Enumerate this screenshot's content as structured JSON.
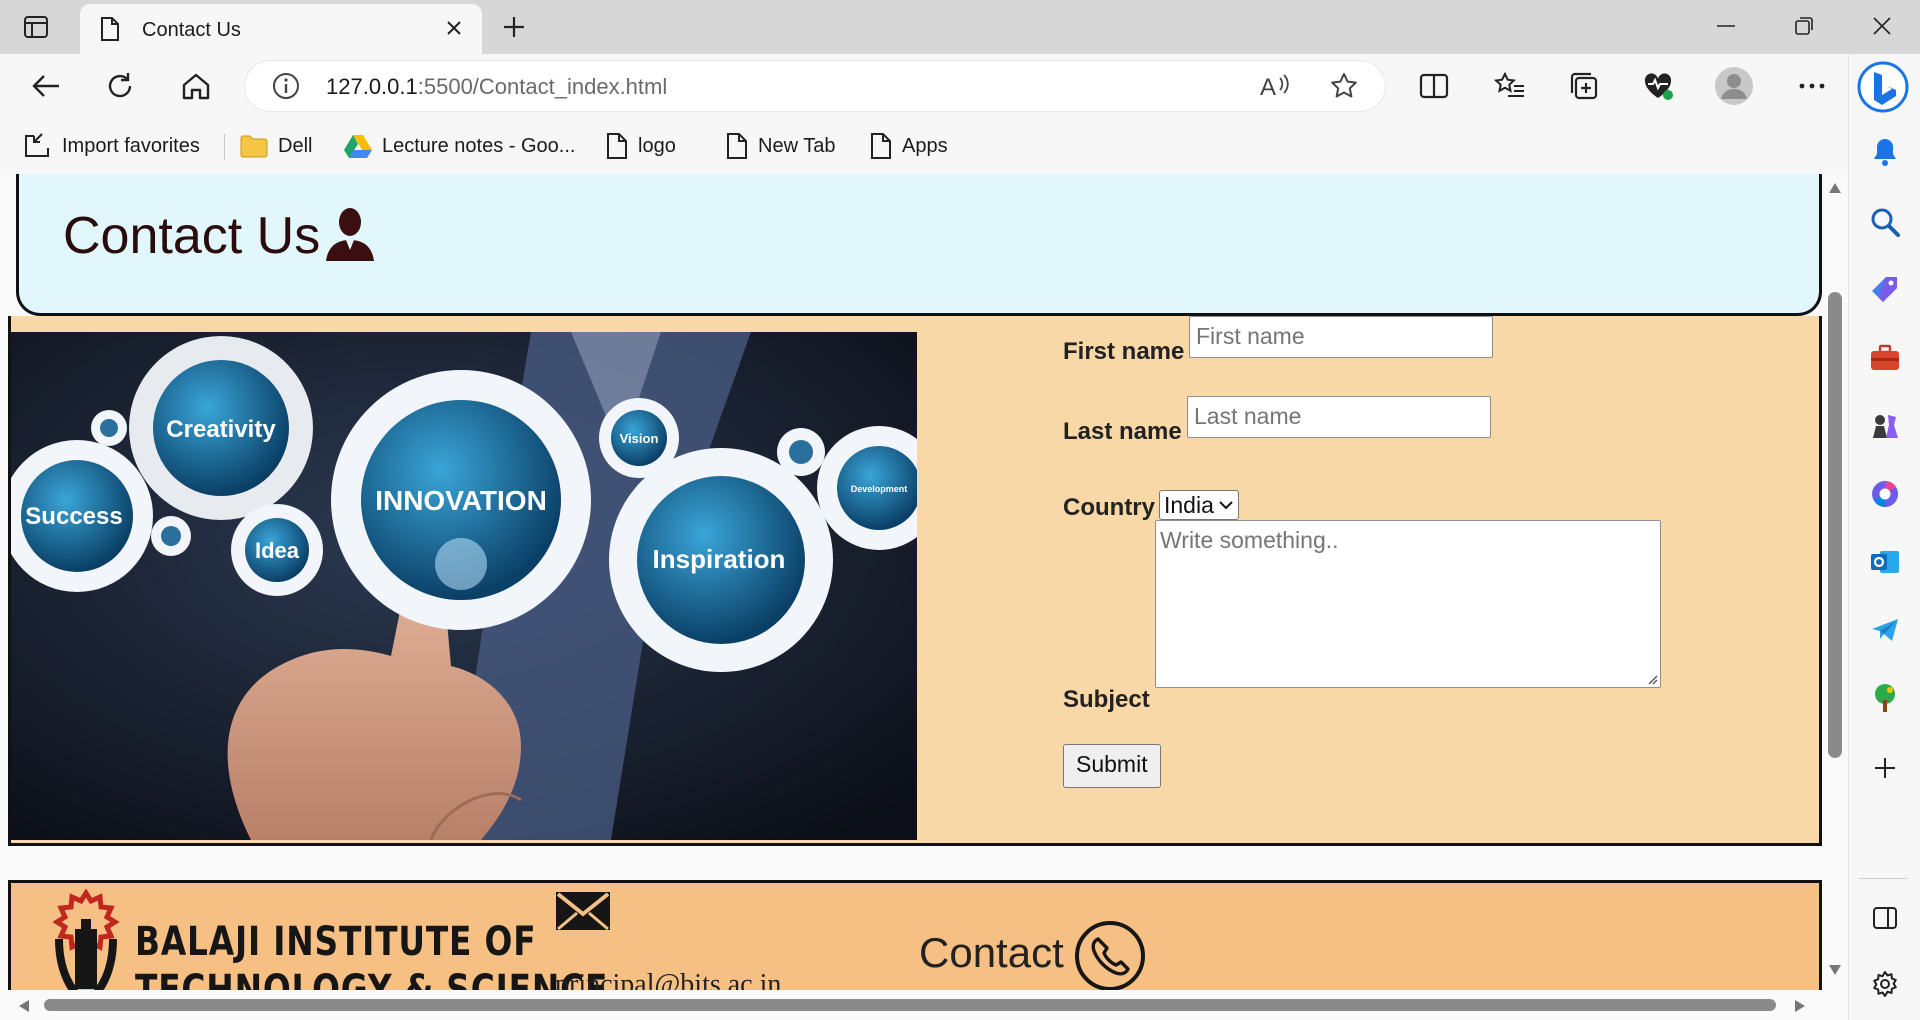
{
  "browser": {
    "tab": {
      "title": "Contact Us"
    },
    "address": {
      "host": "127.0.0.1",
      "path": ":5500/Contact_index.html"
    },
    "favorites": [
      {
        "label": "Import favorites",
        "icon": "import-icon"
      },
      {
        "label": "Dell",
        "icon": "folder-icon"
      },
      {
        "label": "Lecture notes - Goo...",
        "icon": "google-drive-icon"
      },
      {
        "label": "logo",
        "icon": "page-icon"
      },
      {
        "label": "New Tab",
        "icon": "page-icon"
      },
      {
        "label": "Apps",
        "icon": "page-icon"
      }
    ]
  },
  "page": {
    "header": {
      "title": "Contact Us"
    },
    "hero": {
      "gears": [
        "Creativity",
        "Success",
        "Idea",
        "INNOVATION",
        "Vision",
        "Inspiration",
        "Development"
      ]
    },
    "form": {
      "first_name_label": "First name",
      "first_name_placeholder": "First name",
      "last_name_label": "Last name",
      "last_name_placeholder": "Last name",
      "country_label": "Country",
      "country_selected": "India",
      "subject_label": "Subject",
      "subject_placeholder": "Write something..",
      "submit_label": "Submit"
    },
    "footer": {
      "institute_line1": "BALAJI INSTITUTE OF",
      "institute_line2": "TECHNOLOGY & SCIENCE",
      "email": "principal@bits.ac.in",
      "contact_label": "Contact"
    }
  },
  "colors": {
    "header_bg": "#e2f7fb",
    "content_bg": "#f8d8a6",
    "footer_bg": "#f6c085",
    "title_text": "#2a0c0c"
  }
}
